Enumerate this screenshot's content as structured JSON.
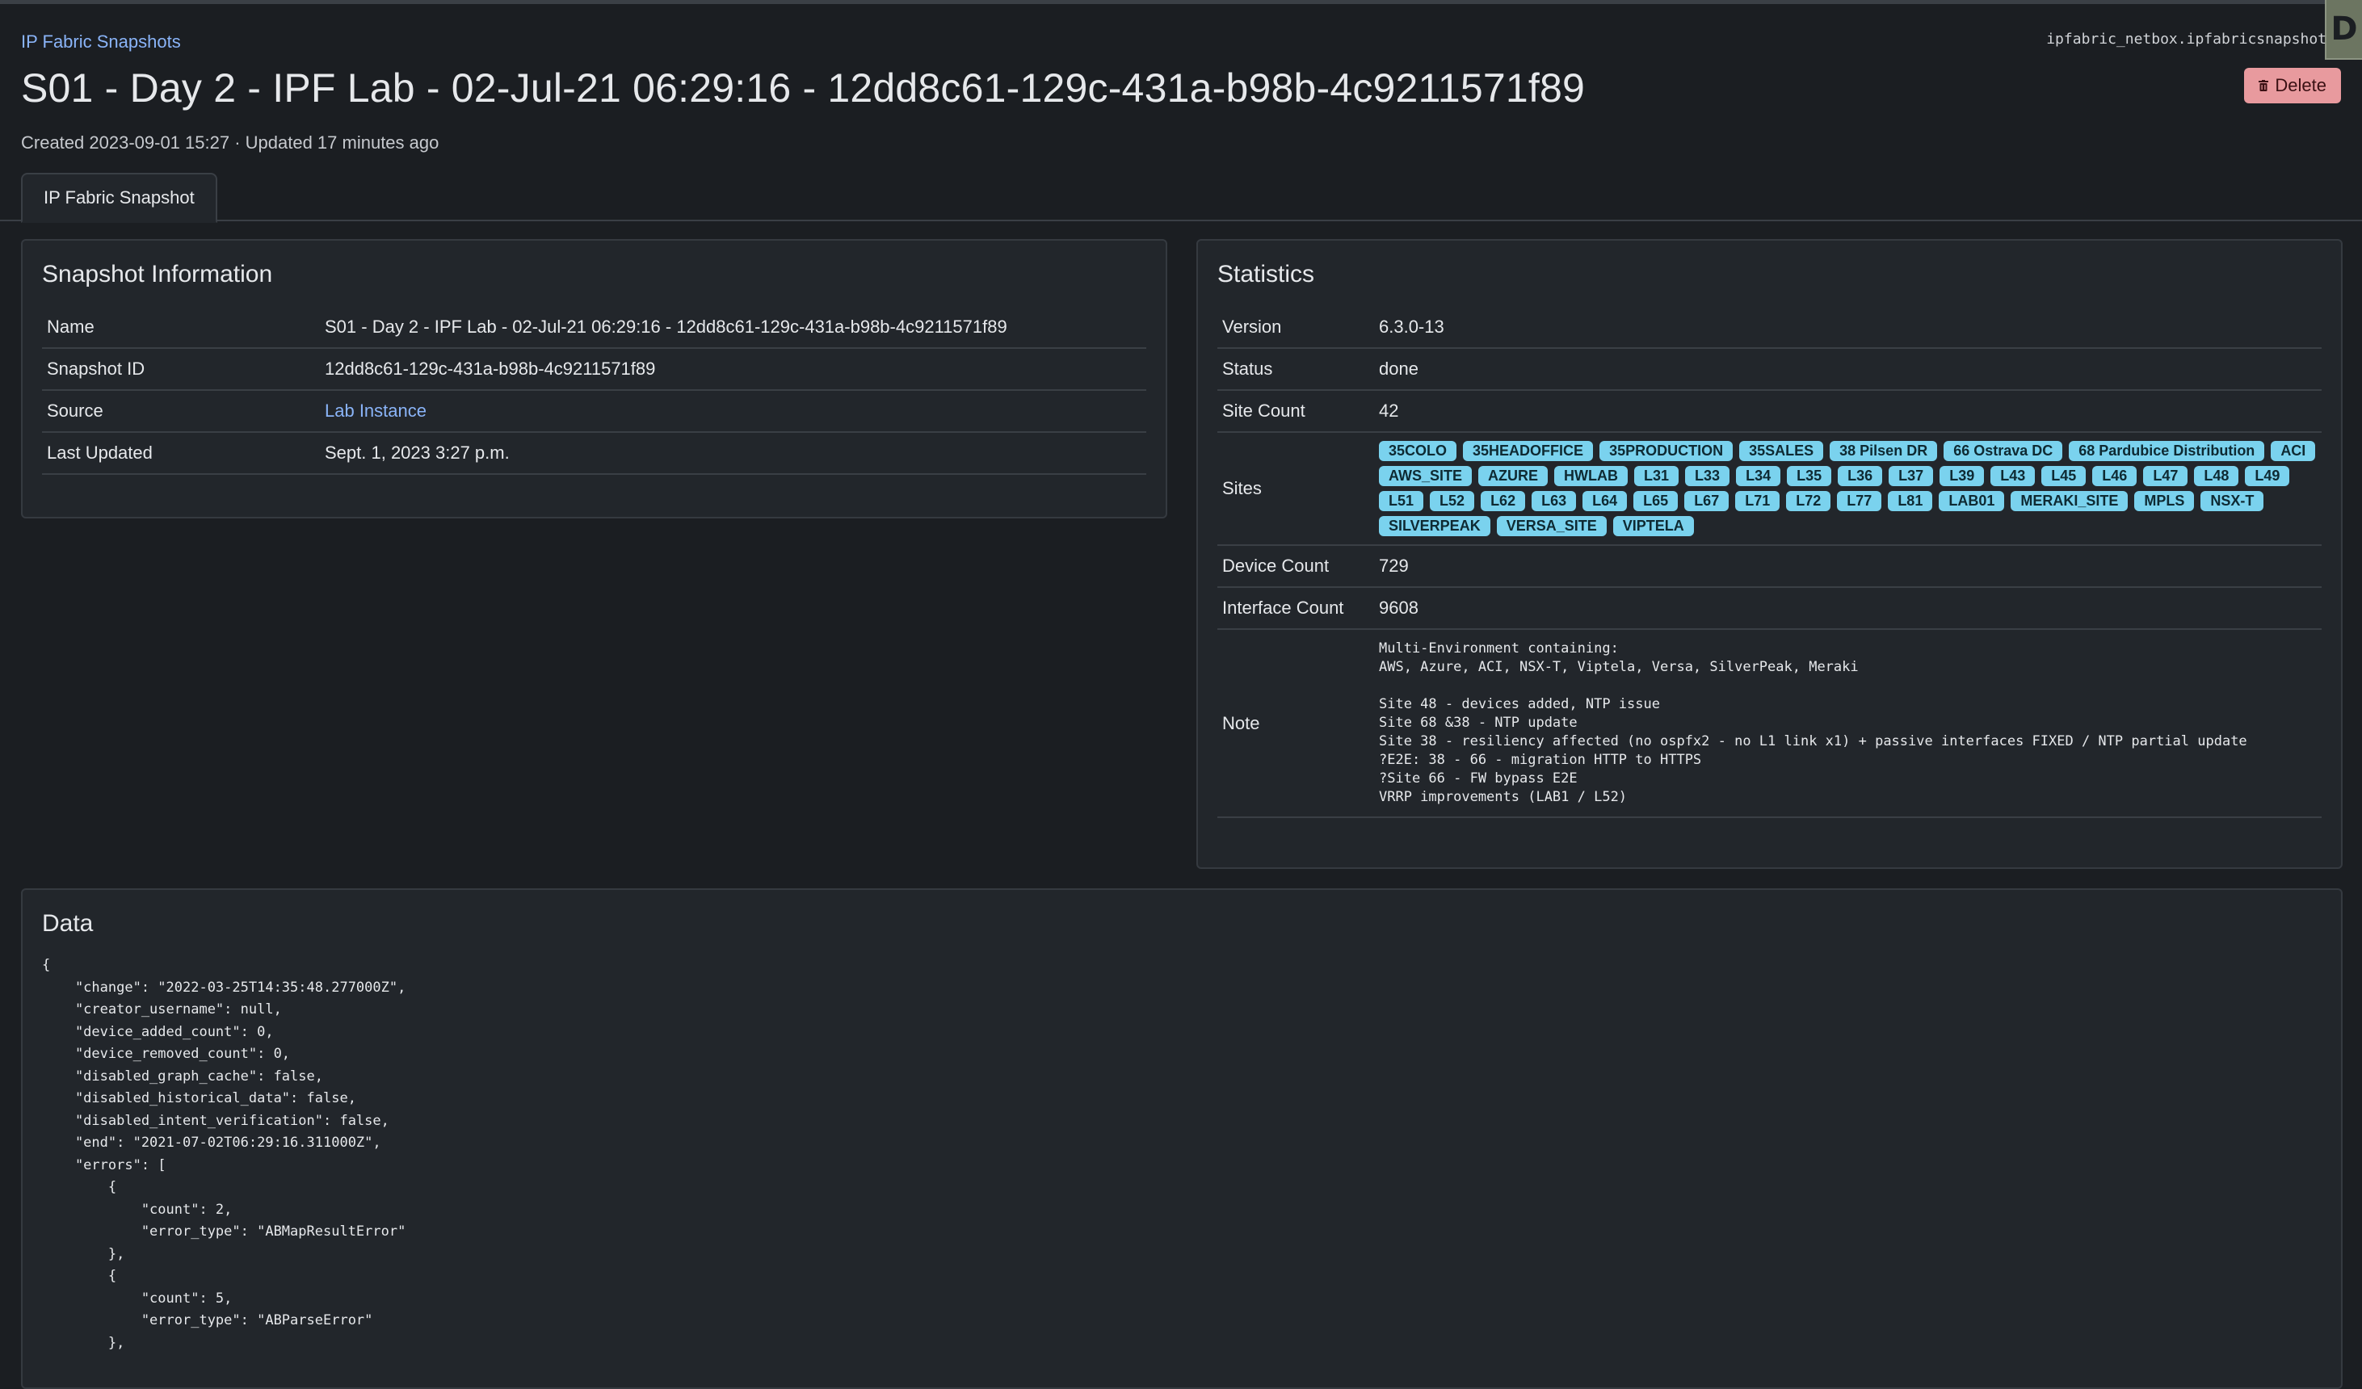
{
  "header": {
    "breadcrumb": "IP Fabric Snapshots",
    "title": "S01 - Day 2 - IPF Lab - 02-Jul-21 06:29:16 - 12dd8c61-129c-431a-b98b-4c9211571f89",
    "created": "Created 2023-09-01 15:27 · Updated 17 minutes ago",
    "model_label": "ipfabric_netbox.ipfabricsnapshot",
    "delete_label": "Delete"
  },
  "tabs": [
    {
      "label": "IP Fabric Snapshot"
    }
  ],
  "snapshot_info": {
    "title": "Snapshot Information",
    "rows": [
      {
        "key": "Name",
        "value": "S01 - Day 2 - IPF Lab - 02-Jul-21 06:29:16 - 12dd8c61-129c-431a-b98b-4c9211571f89"
      },
      {
        "key": "Snapshot ID",
        "value": "12dd8c61-129c-431a-b98b-4c9211571f89"
      },
      {
        "key": "Source",
        "value": "Lab Instance"
      },
      {
        "key": "Last Updated",
        "value": "Sept. 1, 2023 3:27 p.m."
      }
    ]
  },
  "statistics": {
    "title": "Statistics",
    "version_label": "Version",
    "version": "6.3.0-13",
    "status_label": "Status",
    "status": "done",
    "site_count_label": "Site Count",
    "site_count": "42",
    "sites_label": "Sites",
    "sites": [
      "35COLO",
      "35HEADOFFICE",
      "35PRODUCTION",
      "35SALES",
      "38 Pilsen DR",
      "66 Ostrava DC",
      "68 Pardubice Distribution",
      "ACI",
      "AWS_SITE",
      "AZURE",
      "HWLAB",
      "L31",
      "L33",
      "L34",
      "L35",
      "L36",
      "L37",
      "L39",
      "L43",
      "L45",
      "L46",
      "L47",
      "L48",
      "L49",
      "L51",
      "L52",
      "L62",
      "L63",
      "L64",
      "L65",
      "L67",
      "L71",
      "L72",
      "L77",
      "L81",
      "LAB01",
      "MERAKI_SITE",
      "MPLS",
      "NSX-T",
      "SILVERPEAK",
      "VERSA_SITE",
      "VIPTELA"
    ],
    "device_count_label": "Device Count",
    "device_count": "729",
    "interface_count_label": "Interface Count",
    "interface_count": "9608",
    "note_label": "Note",
    "note": "Multi-Environment containing:\nAWS, Azure, ACI, NSX-T, Viptela, Versa, SilverPeak, Meraki\n\nSite 48 - devices added, NTP issue\nSite 68 &38 - NTP update\nSite 38 - resiliency affected (no ospfx2 - no L1 link x1) + passive interfaces FIXED / NTP partial update\n?E2E: 38 - 66 - migration HTTP to HTTPS\n?Site 66 - FW bypass E2E\nVRRP improvements (LAB1 / L52)"
  },
  "data_panel": {
    "title": "Data",
    "json_text": "{\n    \"change\": \"2022-03-25T14:35:48.277000Z\",\n    \"creator_username\": null,\n    \"device_added_count\": 0,\n    \"device_removed_count\": 0,\n    \"disabled_graph_cache\": false,\n    \"disabled_historical_data\": false,\n    \"disabled_intent_verification\": false,\n    \"end\": \"2021-07-02T06:29:16.311000Z\",\n    \"errors\": [\n        {\n            \"count\": 2,\n            \"error_type\": \"ABMapResultError\"\n        },\n        {\n            \"count\": 5,\n            \"error_type\": \"ABParseError\"\n        },"
  },
  "colors": {
    "background": "#1b1e22",
    "card": "#22262b",
    "link": "#8ab4f8",
    "badge": "#7ad2ee",
    "delete": "#e89a9e"
  }
}
